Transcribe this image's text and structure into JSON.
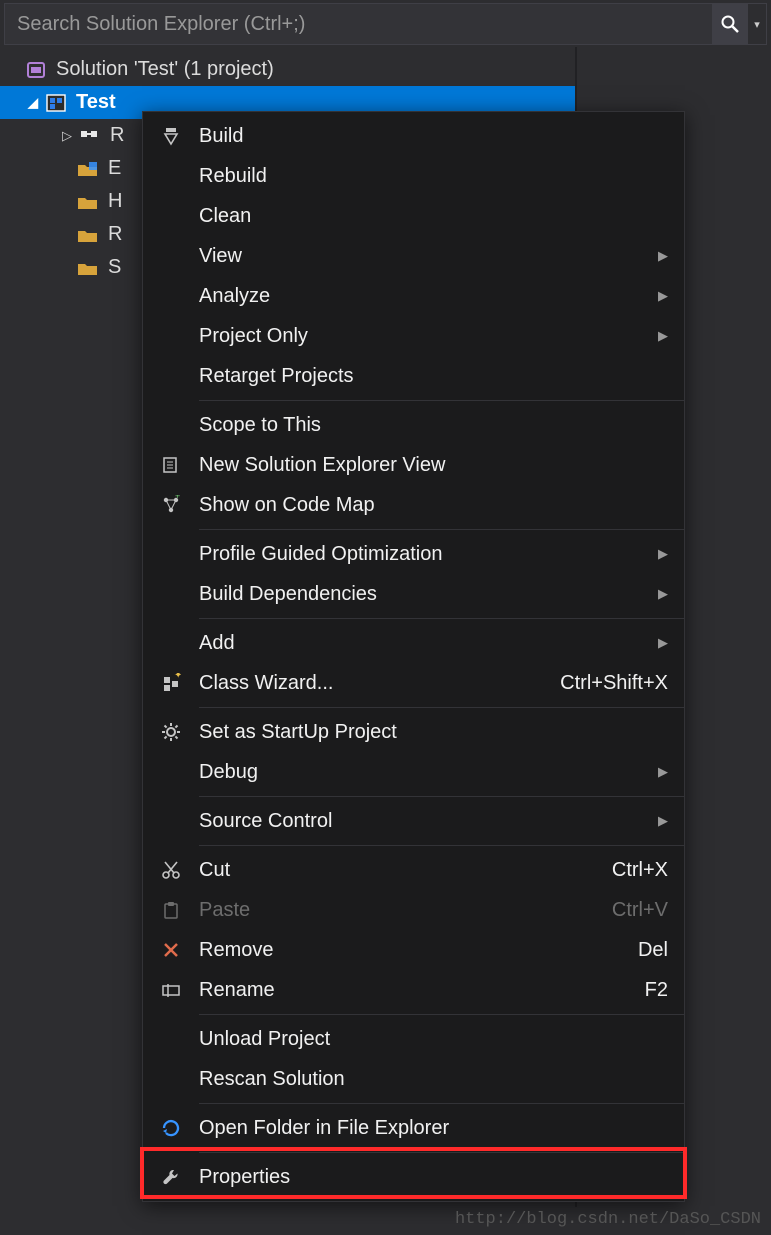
{
  "search": {
    "placeholder": "Search Solution Explorer (Ctrl+;)"
  },
  "tree": {
    "solution": "Solution 'Test' (1 project)",
    "project": "Test",
    "items": [
      "R",
      "E",
      "H",
      "R",
      "S"
    ]
  },
  "menu": {
    "build": "Build",
    "rebuild": "Rebuild",
    "clean": "Clean",
    "view": "View",
    "analyze": "Analyze",
    "project_only": "Project Only",
    "retarget": "Retarget Projects",
    "scope": "Scope to This",
    "new_view": "New Solution Explorer View",
    "code_map": "Show on Code Map",
    "pgo": "Profile Guided Optimization",
    "build_deps": "Build Dependencies",
    "add": "Add",
    "class_wizard": "Class Wizard...",
    "class_wizard_sc": "Ctrl+Shift+X",
    "startup": "Set as StartUp Project",
    "debug": "Debug",
    "source_ctrl": "Source Control",
    "cut": "Cut",
    "cut_sc": "Ctrl+X",
    "paste": "Paste",
    "paste_sc": "Ctrl+V",
    "remove": "Remove",
    "remove_sc": "Del",
    "rename": "Rename",
    "rename_sc": "F2",
    "unload": "Unload Project",
    "rescan": "Rescan Solution",
    "open_folder": "Open Folder in File Explorer",
    "properties": "Properties"
  },
  "watermark": "http://blog.csdn.net/DaSo_CSDN"
}
